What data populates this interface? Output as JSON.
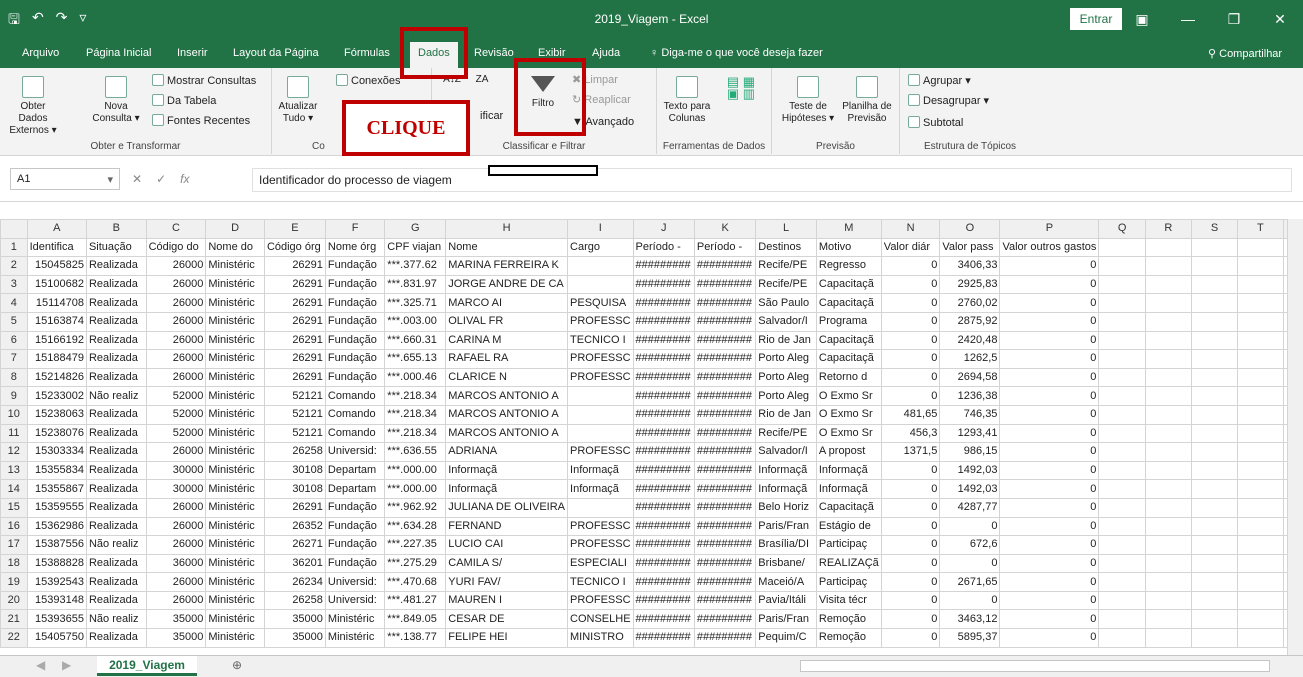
{
  "window": {
    "title": "2019_Viagem  -  Excel",
    "signin": "Entrar"
  },
  "tabs": [
    "Arquivo",
    "Página Inicial",
    "Inserir",
    "Layout da Página",
    "Fórmulas",
    "Dados",
    "Revisão",
    "Exibir",
    "Ajuda"
  ],
  "tell": "Diga-me o que você deseja fazer",
  "share": "Compartilhar",
  "ribbon": {
    "get": {
      "external": "Obter Dados Externos",
      "new_query": "Nova Consulta",
      "show_queries": "Mostrar Consultas",
      "from_table": "Da Tabela",
      "recent": "Fontes Recentes",
      "label": "Obter e Transformar"
    },
    "conn": {
      "refresh": "Atualizar Tudo",
      "connections": "Conexões",
      "label": "Co"
    },
    "sort": {
      "sort": "ificar",
      "filter": "Filtro",
      "clear": "Limpar",
      "reapply": "Reaplicar",
      "advanced": "Avançado",
      "label": "Classificar e Filtrar"
    },
    "tools": {
      "text_to_cols": "Texto para Colunas",
      "label": "Ferramentas de Dados"
    },
    "forecast": {
      "whatif": "Teste de Hipóteses",
      "sheet": "Planilha de Previsão",
      "label": "Previsão"
    },
    "outline": {
      "group": "Agrupar",
      "ungroup": "Desagrupar",
      "subtotal": "Subtotal",
      "label": "Estrutura de Tópicos"
    }
  },
  "annotation": "CLIQUE",
  "formula": {
    "cell": "A1",
    "fx": "fx",
    "value": "Identificador do processo de viagem"
  },
  "columns": [
    "A",
    "B",
    "C",
    "D",
    "E",
    "F",
    "G",
    "H",
    "I",
    "J",
    "K",
    "L",
    "M",
    "N",
    "O",
    "P",
    "Q",
    "R",
    "S",
    "T",
    "U"
  ],
  "header_row": [
    "Identifica",
    "Situação",
    "Código do",
    "Nome do",
    "Código órg",
    "Nome órg",
    "CPF viajan",
    "Nome",
    "Cargo",
    "Período -",
    "Período -",
    "Destinos",
    "Motivo",
    "Valor diár",
    "Valor pass",
    "Valor outros gastos",
    "",
    "",
    "",
    "",
    ""
  ],
  "rows": [
    [
      "15045825",
      "Realizada",
      "26000",
      "Ministéric",
      "26291",
      "Fundação",
      "***.377.62",
      "MARINA FERREIRA K",
      "",
      "#########",
      "#########",
      "Recife/PE",
      "Regresso",
      "0",
      "3406,33",
      "0"
    ],
    [
      "15100682",
      "Realizada",
      "26000",
      "Ministéric",
      "26291",
      "Fundação",
      "***.831.97",
      "JORGE ANDRE DE CA",
      "",
      "#########",
      "#########",
      "Recife/PE",
      "Capacitaçã",
      "0",
      "2925,83",
      "0"
    ],
    [
      "15114708",
      "Realizada",
      "26000",
      "Ministéric",
      "26291",
      "Fundação",
      "***.325.71",
      "MARCO AI",
      "PESQUISA",
      "#########",
      "#########",
      "São Paulo",
      "Capacitaçã",
      "0",
      "2760,02",
      "0"
    ],
    [
      "15163874",
      "Realizada",
      "26000",
      "Ministéric",
      "26291",
      "Fundação",
      "***.003.00",
      "OLIVAL FR",
      "PROFESSC",
      "#########",
      "#########",
      "Salvador/I",
      "Programa",
      "0",
      "2875,92",
      "0"
    ],
    [
      "15166192",
      "Realizada",
      "26000",
      "Ministéric",
      "26291",
      "Fundação",
      "***.660.31",
      "CARINA M",
      "TECNICO I",
      "#########",
      "#########",
      "Rio de Jan",
      "Capacitaçã",
      "0",
      "2420,48",
      "0"
    ],
    [
      "15188479",
      "Realizada",
      "26000",
      "Ministéric",
      "26291",
      "Fundação",
      "***.655.13",
      "RAFAEL RA",
      "PROFESSC",
      "#########",
      "#########",
      "Porto Aleg",
      "Capacitaçã",
      "0",
      "1262,5",
      "0"
    ],
    [
      "15214826",
      "Realizada",
      "26000",
      "Ministéric",
      "26291",
      "Fundação",
      "***.000.46",
      "CLARICE N",
      "PROFESSC",
      "#########",
      "#########",
      "Porto Aleg",
      "Retorno d",
      "0",
      "2694,58",
      "0"
    ],
    [
      "15233002",
      "Não realiz",
      "52000",
      "Ministéric",
      "52121",
      "Comando",
      "***.218.34",
      "MARCOS ANTONIO A",
      "",
      "#########",
      "#########",
      "Porto Aleg",
      "O Exmo Sr",
      "0",
      "1236,38",
      "0"
    ],
    [
      "15238063",
      "Realizada",
      "52000",
      "Ministéric",
      "52121",
      "Comando",
      "***.218.34",
      "MARCOS ANTONIO A",
      "",
      "#########",
      "#########",
      "Rio de Jan",
      "O Exmo Sr",
      "481,65",
      "746,35",
      "0"
    ],
    [
      "15238076",
      "Realizada",
      "52000",
      "Ministéric",
      "52121",
      "Comando",
      "***.218.34",
      "MARCOS ANTONIO A",
      "",
      "#########",
      "#########",
      "Recife/PE",
      "O Exmo Sr",
      "456,3",
      "1293,41",
      "0"
    ],
    [
      "15303334",
      "Realizada",
      "26000",
      "Ministéric",
      "26258",
      "Universid:",
      "***.636.55",
      "ADRIANA",
      "PROFESSC",
      "#########",
      "#########",
      "Salvador/I",
      "A propost",
      "1371,5",
      "986,15",
      "0"
    ],
    [
      "15355834",
      "Realizada",
      "30000",
      "Ministéric",
      "30108",
      "Departam",
      "***.000.00",
      "Informaçã",
      "Informaçã",
      "#########",
      "#########",
      "Informaçã",
      "Informaçã",
      "0",
      "1492,03",
      "0"
    ],
    [
      "15355867",
      "Realizada",
      "30000",
      "Ministéric",
      "30108",
      "Departam",
      "***.000.00",
      "Informaçã",
      "Informaçã",
      "#########",
      "#########",
      "Informaçã",
      "Informaçã",
      "0",
      "1492,03",
      "0"
    ],
    [
      "15359555",
      "Realizada",
      "26000",
      "Ministéric",
      "26291",
      "Fundação",
      "***.962.92",
      "JULIANA DE OLIVEIRA",
      "",
      "#########",
      "#########",
      "Belo Horiz",
      "Capacitaçã",
      "0",
      "4287,77",
      "0"
    ],
    [
      "15362986",
      "Realizada",
      "26000",
      "Ministéric",
      "26352",
      "Fundação",
      "***.634.28",
      "FERNAND",
      "PROFESSC",
      "#########",
      "#########",
      "Paris/Fran",
      "Estágio de",
      "0",
      "0",
      "0"
    ],
    [
      "15387556",
      "Não realiz",
      "26000",
      "Ministéric",
      "26271",
      "Fundação",
      "***.227.35",
      "LUCIO CAI",
      "PROFESSC",
      "#########",
      "#########",
      "Brasília/DI",
      "Participaç",
      "0",
      "672,6",
      "0"
    ],
    [
      "15388828",
      "Realizada",
      "36000",
      "Ministéric",
      "36201",
      "Fundação",
      "***.275.29",
      "CAMILA S/",
      "ESPECIALI",
      "#########",
      "#########",
      "Brisbane/",
      "REALIZAÇã",
      "0",
      "0",
      "0"
    ],
    [
      "15392543",
      "Realizada",
      "26000",
      "Ministéric",
      "26234",
      "Universid:",
      "***.470.68",
      "YURI FAV/",
      "TECNICO I",
      "#########",
      "#########",
      "Maceió/A",
      "Participaç",
      "0",
      "2671,65",
      "0"
    ],
    [
      "15393148",
      "Realizada",
      "26000",
      "Ministéric",
      "26258",
      "Universid:",
      "***.481.27",
      "MAUREN I",
      "PROFESSC",
      "#########",
      "#########",
      "Pavia/Itáli",
      "Visita técr",
      "0",
      "0",
      "0"
    ],
    [
      "15393655",
      "Não realiz",
      "35000",
      "Ministéric",
      "35000",
      "Ministéric",
      "***.849.05",
      "CESAR DE",
      "CONSELHE",
      "#########",
      "#########",
      "Paris/Fran",
      "Remoção",
      "0",
      "3463,12",
      "0"
    ],
    [
      "15405750",
      "Realizada",
      "35000",
      "Ministéric",
      "35000",
      "Ministéric",
      "***.138.77",
      "FELIPE HEI",
      "MINISTRO",
      "#########",
      "#########",
      "Pequim/C",
      "Remoção",
      "0",
      "5895,37",
      "0"
    ]
  ],
  "sheet": {
    "name": "2019_Viagem",
    "add": "⊕"
  },
  "colors": {
    "excel_green": "#217346",
    "annotation_red": "#c00000"
  }
}
